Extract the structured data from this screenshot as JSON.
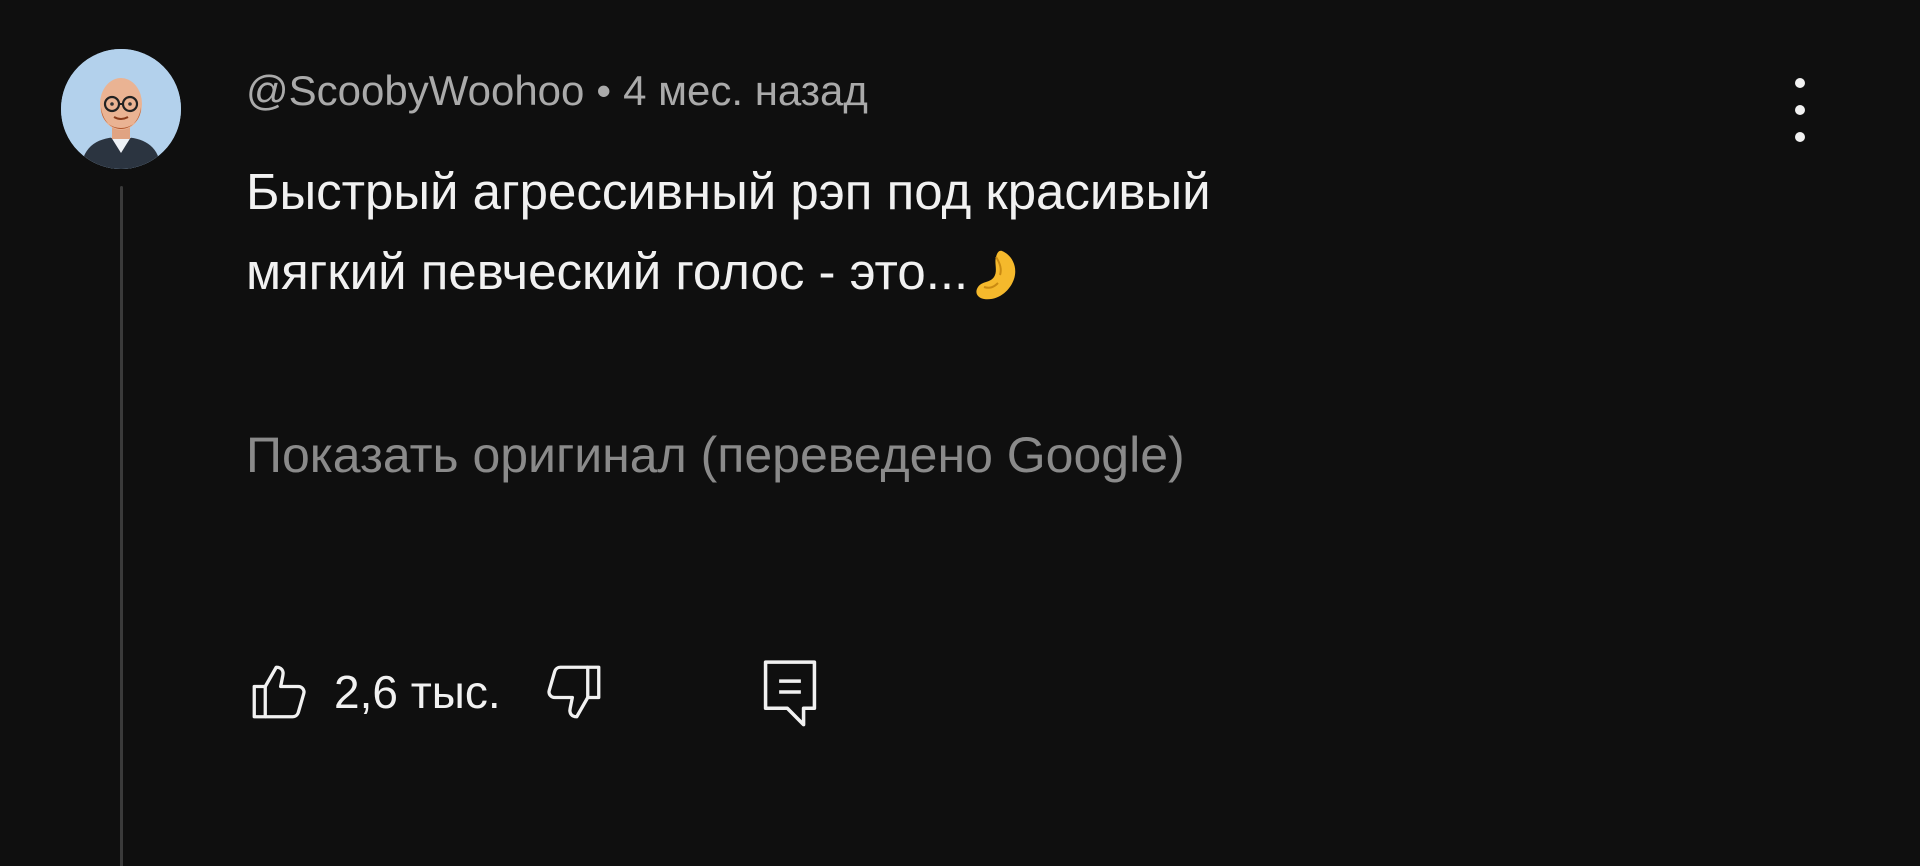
{
  "comment": {
    "author": "@ScoobyWoohoo",
    "separator": "•",
    "time": "4 мес. назад",
    "text_line1": "Быстрый агрессивный рэп под красивый",
    "text_line2": "мягкий певческий голос - это...",
    "emoji": "pinched-fingers-emoji",
    "translate_link": "Показать оригинал (переведено Google)",
    "like_count": "2,6 тыс."
  },
  "icons": {
    "avatar": "cartoon-man-avatar",
    "like": "thumbs-up-icon",
    "dislike": "thumbs-down-icon",
    "reply": "reply-comment-icon",
    "menu": "more-vertical-icon"
  },
  "colors": {
    "background": "#0f0f0f",
    "text_primary": "#f1f1f1",
    "text_secondary": "#aaaaaa",
    "link_muted": "#8a8a8a"
  }
}
